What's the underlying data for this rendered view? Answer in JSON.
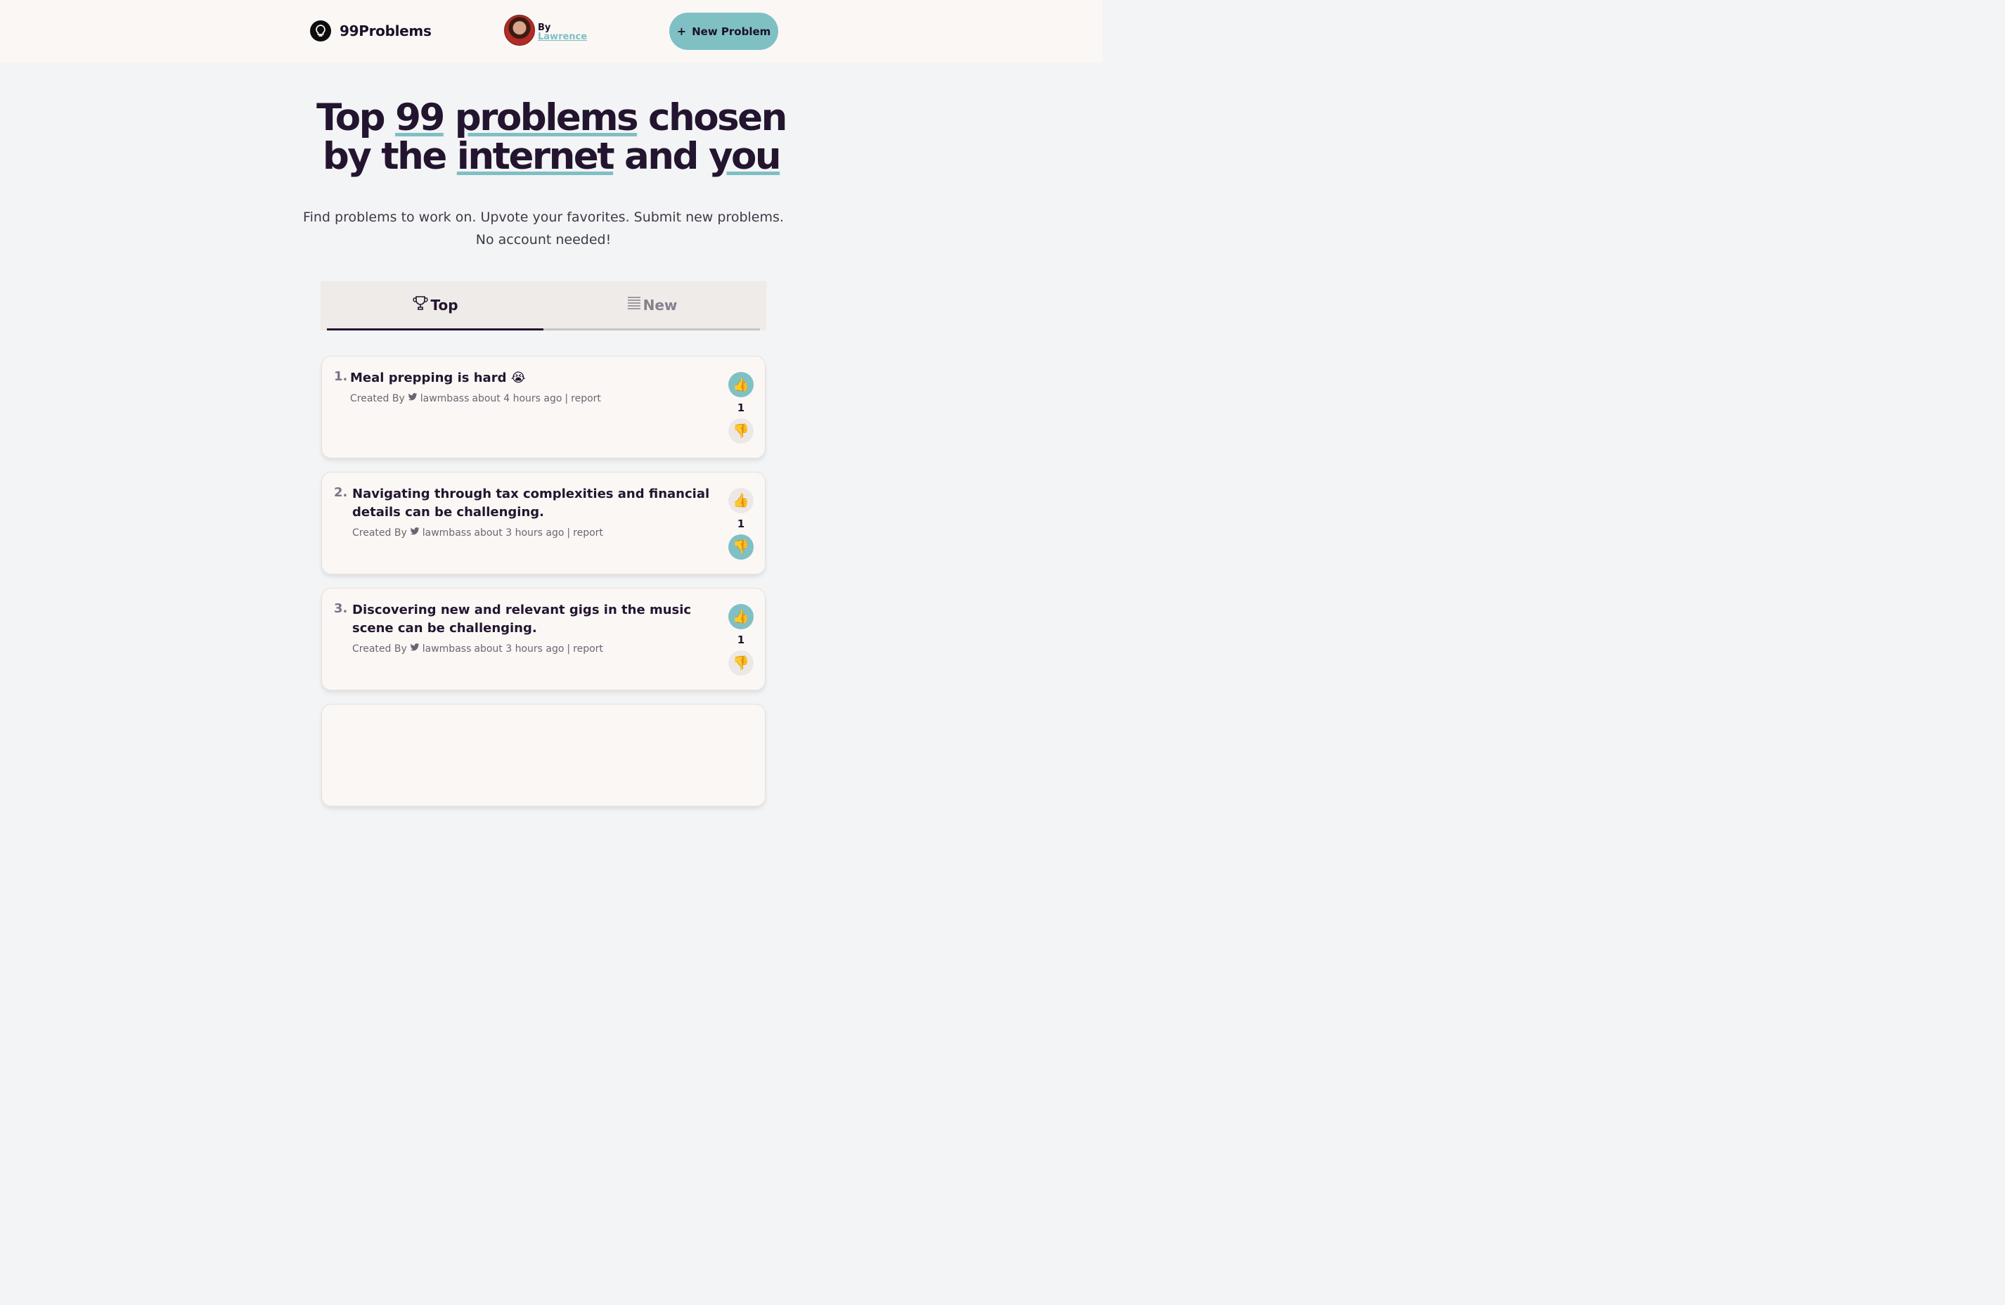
{
  "header": {
    "brand": "99Problems",
    "author_by": "By",
    "author_name": "Lawrence",
    "new_button": "New Problem",
    "new_button_icon": "+"
  },
  "hero": {
    "line1": [
      "Top",
      "99",
      "problems",
      "chosen"
    ],
    "line2": [
      "by the",
      "internet",
      "and",
      "you"
    ],
    "subtitle_line1": "Find problems to work on. Upvote your favorites. Submit new problems.",
    "subtitle_line2": "No account needed!"
  },
  "colors": {
    "accent": "#7fc0c5",
    "text": "#23152f",
    "card": "#faf7f5"
  },
  "tabs": [
    {
      "label": "Top",
      "icon": "trophy-icon",
      "active": true
    },
    {
      "label": "New",
      "icon": "list-icon",
      "active": false
    }
  ],
  "problems": [
    {
      "rank": "1.",
      "title": "Meal prepping is hard 😭",
      "created_by": "Created By",
      "user": "lawmbass",
      "time": "about 4 hours ago",
      "sep": "|",
      "report": "report",
      "votes": "1",
      "up_active": true,
      "down_active": false,
      "up_icon": "👍",
      "down_icon": "👎"
    },
    {
      "rank": "2.",
      "title": "Navigating through tax complexities and financial details can be challenging.",
      "created_by": "Created By",
      "user": "lawmbass",
      "time": "about 3 hours ago",
      "sep": "|",
      "report": "report",
      "votes": "1",
      "up_active": false,
      "down_active": true,
      "up_icon": "👍",
      "down_icon": "👎"
    },
    {
      "rank": "3.",
      "title": "Discovering new and relevant gigs in the music scene can be challenging.",
      "created_by": "Created By",
      "user": "lawmbass",
      "time": "about 3 hours ago",
      "sep": "|",
      "report": "report",
      "votes": "1",
      "up_active": true,
      "down_active": false,
      "up_icon": "👍",
      "down_icon": "👎"
    }
  ]
}
